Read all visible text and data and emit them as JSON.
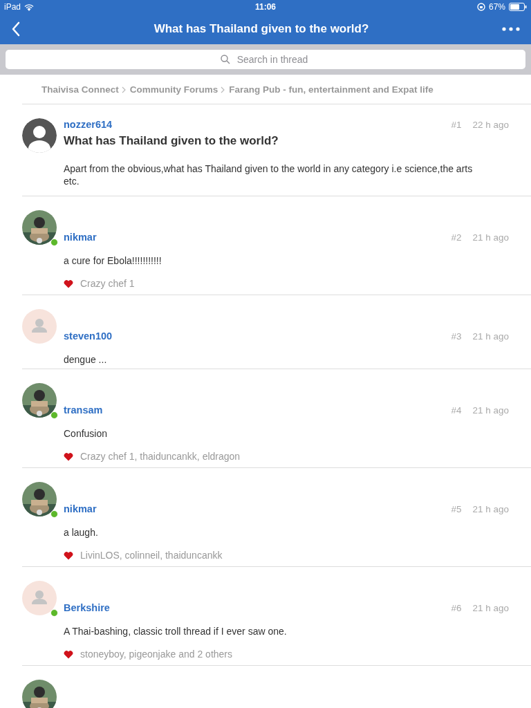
{
  "status_bar": {
    "device": "iPad",
    "time": "11:06",
    "battery": "67%"
  },
  "nav_bar": {
    "title": "What has Thailand given to the world?"
  },
  "search": {
    "placeholder": "Search in thread"
  },
  "breadcrumbs": [
    "Thaivisa Connect",
    "Community Forums",
    "Farang Pub - fun, entertainment and Expat life"
  ],
  "posts": [
    {
      "author": "nozzer614",
      "avatar": {
        "kind": "default"
      },
      "online": false,
      "number": "#1",
      "time": "22 h ago",
      "title": "What has Thailand given to the world?",
      "body": "Apart from the obvious,what has Thailand given to the world in any category i.e science,the arts etc."
    },
    {
      "author": "nikmar",
      "online": true,
      "number": "#2",
      "time": "21 h ago",
      "body": "a cure for Ebola!!!!!!!!!!!",
      "likes": "Crazy chef 1"
    },
    {
      "author": "steven100",
      "avatar": {
        "kind": "placeholder"
      },
      "online": false,
      "number": "#3",
      "time": "21 h ago",
      "body": "dengue ..."
    },
    {
      "author": "transam",
      "online": true,
      "number": "#4",
      "time": "21 h ago",
      "body": "Confusion",
      "likes": "Crazy chef 1, thaiduncankk, eldragon"
    },
    {
      "author": "nikmar",
      "online": true,
      "number": "#5",
      "time": "21 h ago",
      "body": "a laugh.",
      "likes": "LivinLOS, colinneil, thaiduncankk"
    },
    {
      "author": "Berkshire",
      "avatar": {
        "kind": "placeholder"
      },
      "online": true,
      "number": "#6",
      "time": "21 h ago",
      "body": "A Thai-bashing, classic troll thread if I ever saw one.",
      "likes": "stoneyboy, pigeonjake and 2 others"
    },
    {
      "online": false
    }
  ]
}
